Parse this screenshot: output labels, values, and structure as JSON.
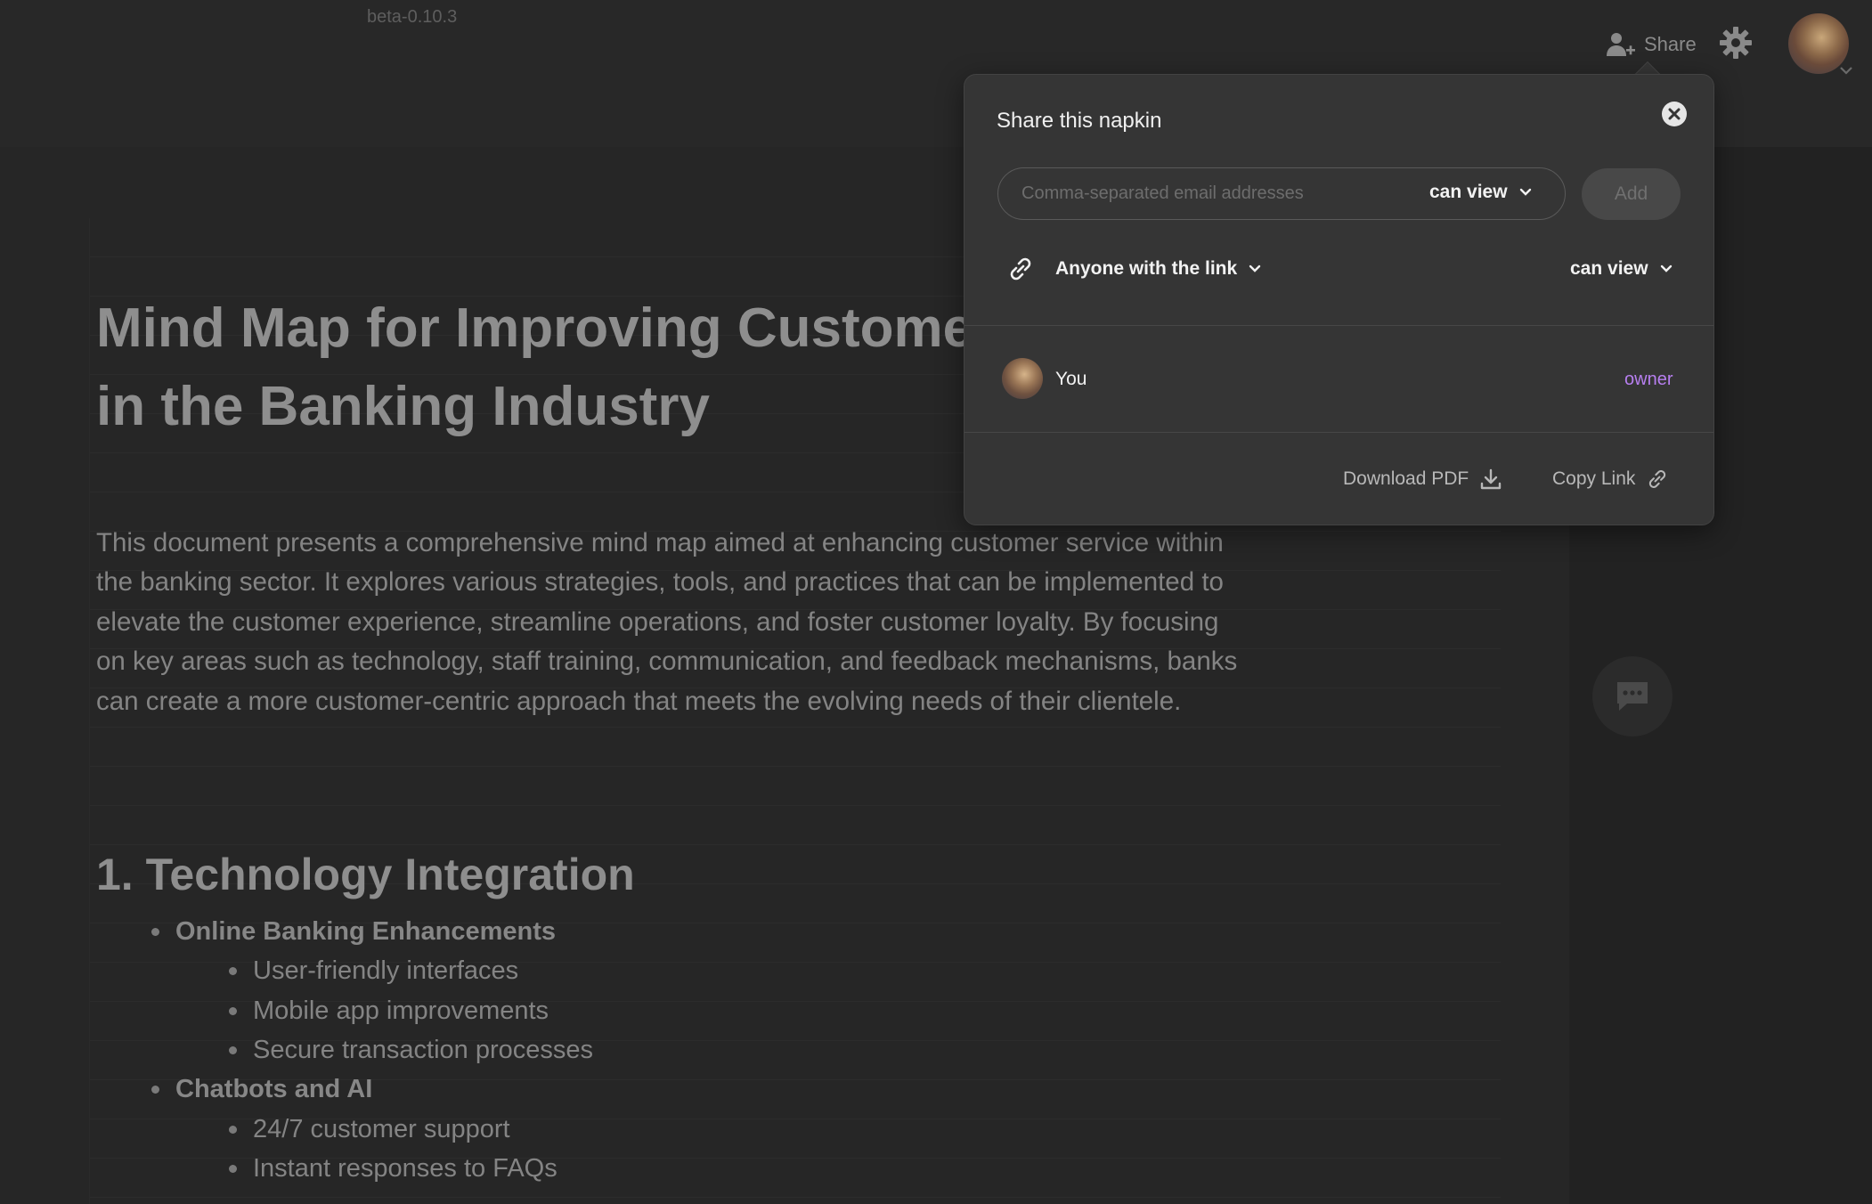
{
  "app": {
    "version": "beta-0.10.3",
    "share_label": "Share"
  },
  "document": {
    "title_line1": "Mind Map for Improving Customer",
    "title_line2": "in the Banking Industry",
    "intro": "This document presents a comprehensive mind map aimed at enhancing customer service within the banking sector. It explores various strategies, tools, and practices that can be implemented to elevate the customer experience, streamline operations, and foster customer loyalty. By focusing on key areas such as technology, staff training, communication, and feedback mechanisms, banks can create a more customer-centric approach that meets the evolving needs of their clientele.",
    "section1_heading": "1. Technology Integration",
    "outline": [
      {
        "label": "Online Banking Enhancements",
        "children": [
          "User-friendly interfaces",
          "Mobile app improvements",
          "Secure transaction processes"
        ]
      },
      {
        "label": "Chatbots and AI",
        "children": [
          "24/7 customer support",
          "Instant responses to FAQs"
        ]
      }
    ]
  },
  "share_modal": {
    "title": "Share this napkin",
    "email_placeholder": "Comma-separated email addresses",
    "invite_permission": "can view",
    "add_label": "Add",
    "link_scope": "Anyone with the link",
    "link_permission": "can view",
    "member_name": "You",
    "member_role": "owner",
    "download_label": "Download PDF",
    "copy_link_label": "Copy Link"
  },
  "colors": {
    "background": "#262626",
    "modal": "#353535",
    "owner_accent": "#b77ff0"
  },
  "icons": [
    "add-user-icon",
    "gear-icon",
    "chevron-down-icon",
    "close-icon",
    "link-icon",
    "download-icon",
    "chat-icon"
  ]
}
